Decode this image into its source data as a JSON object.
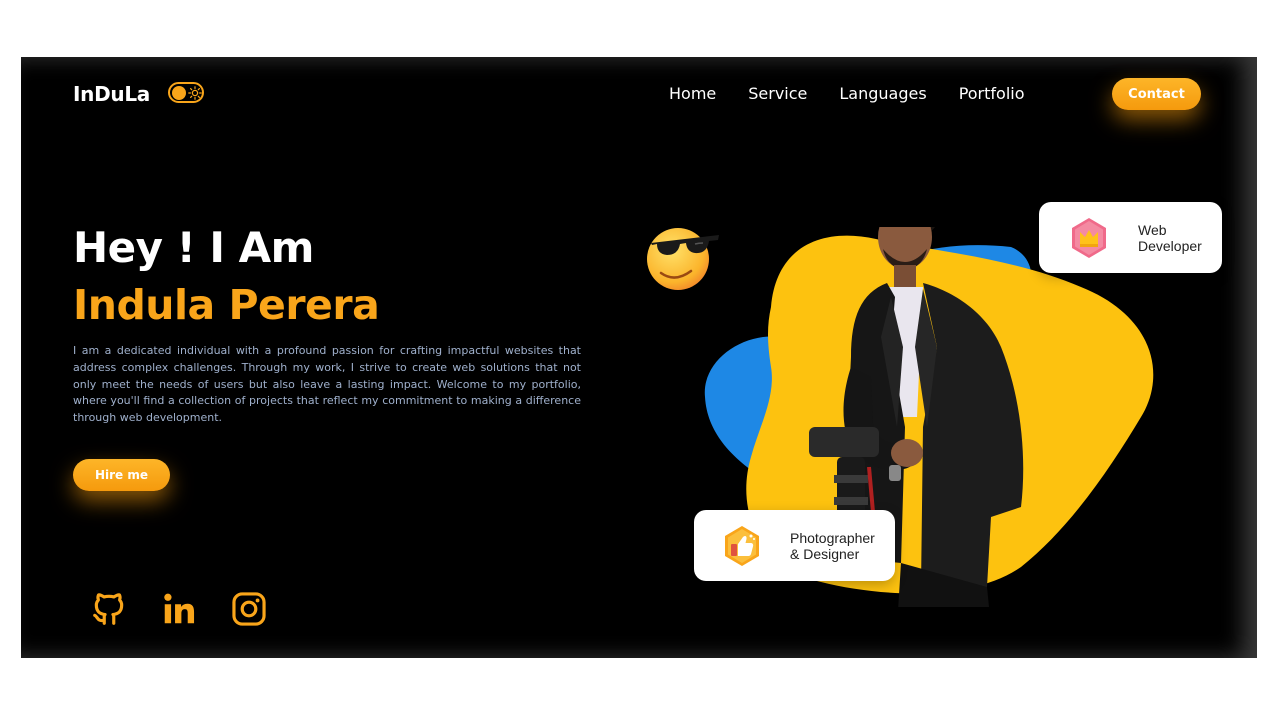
{
  "header": {
    "logo": "InDuLa",
    "theme_toggle_icon": "sun-icon",
    "nav": [
      "Home",
      "Service",
      "Languages",
      "Portfolio"
    ],
    "contact_label": "Contact"
  },
  "hero": {
    "greeting": "Hey ! I Am",
    "name": "Indula Perera",
    "description": "I am a dedicated individual with a profound passion for crafting impactful websites that address complex challenges. Through my work, I strive to create web solutions that not only meet the needs of users but also leave a lasting impact. Welcome to my portfolio, where you'll find a collection of projects that reflect my commitment to making a difference through web development.",
    "hire_label": "Hire me"
  },
  "socials": [
    "github-icon",
    "linkedin-icon",
    "instagram-icon"
  ],
  "cards": {
    "web": {
      "line1": "Web",
      "line2": "Developer",
      "icon": "crown-icon"
    },
    "photo": {
      "line1": "Photographer",
      "line2": "& Designer",
      "icon": "thumbs-up-icon"
    }
  },
  "colors": {
    "accent": "#f9a51a",
    "blob_yellow": "#fdc20f",
    "blob_blue": "#1e88e5",
    "background": "#000000"
  }
}
